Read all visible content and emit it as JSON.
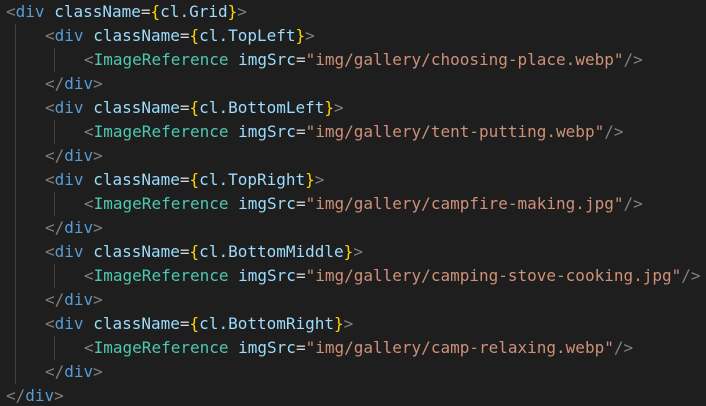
{
  "editor": {
    "outer_tag": "div",
    "outer_attr": "className",
    "outer_expr": "cl.Grid",
    "close_tag": "div",
    "component": "ImageReference",
    "component_attr": "imgSrc",
    "blocks": [
      {
        "class_expr": "cl.TopLeft",
        "img": "img/gallery/choosing-place.webp"
      },
      {
        "class_expr": "cl.BottomLeft",
        "img": "img/gallery/tent-putting.webp"
      },
      {
        "class_expr": "cl.TopRight",
        "img": "img/gallery/campfire-making.jpg"
      },
      {
        "class_expr": "cl.BottomMiddle",
        "img": "img/gallery/camping-stove-cooking.jpg"
      },
      {
        "class_expr": "cl.BottomRight",
        "img": "img/gallery/camp-relaxing.webp"
      }
    ]
  },
  "colors": {
    "background": "#1e1e1e",
    "tag": "#569cd6",
    "component": "#4ec9b0",
    "attribute": "#9cdcfe",
    "string": "#ce9178",
    "bracket": "#ffd700",
    "punctuation": "#808080"
  }
}
